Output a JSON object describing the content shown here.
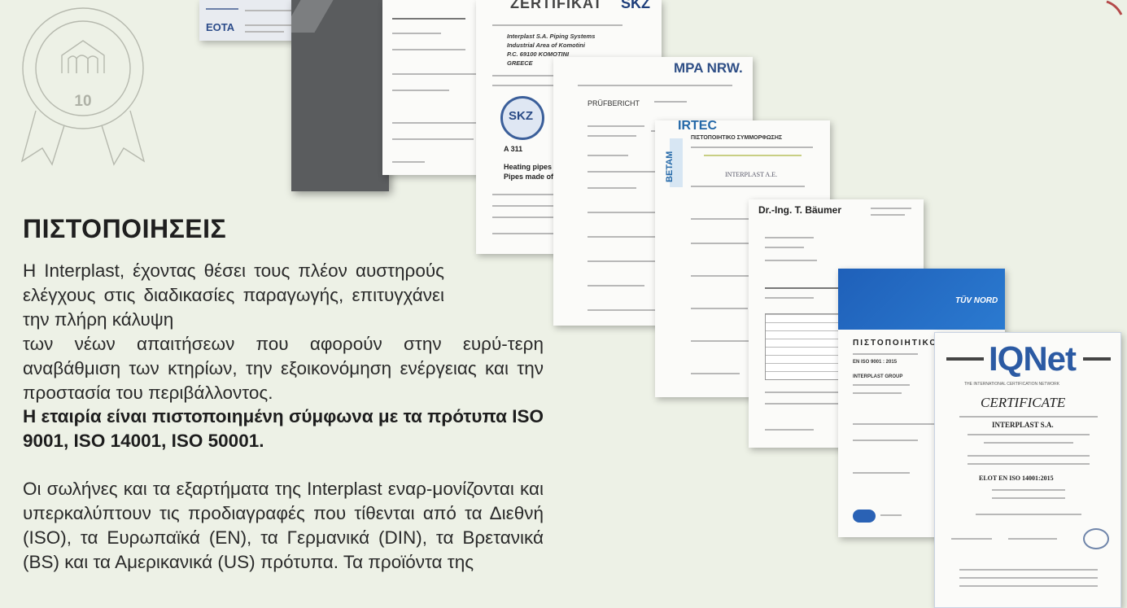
{
  "badge": {
    "number": "10"
  },
  "heading": "ΠΙΣΤΟΠΟΙΗΣΕΙΣ",
  "paragraphs": {
    "p1": "Η Interplast, έχοντας θέσει τους πλέον αυστηρούς ελέγχους στις διαδικασίες παραγωγής, επιτυγχάνει την πλήρη κάλυψη",
    "p2": "των νέων απαιτήσεων που αφορούν στην ευρύ-τερη αναβάθμιση των κτηρίων, την εξοικονόμηση ενέργειας και την προστασία του περιβάλλοντος.",
    "p3": "Η εταιρία είναι πιστοποιημένη σύμφωνα με τα πρότυπα ISO 9001, ISO 14001, ISO 50001.",
    "p4": "Οι σωλήνες και τα εξαρτήματα της Interplast εναρ-μονίζονται και υπερκαλύπτουν τις προδιαγραφές που τίθενται από τα Διεθνή (ISO), τα Ευρωπαϊκά (EN), τα Γερμανικά (DIN), τα Βρετανικά (BS) και τα Αμερικανικά (US) πρότυπα. Τα προϊόντα της"
  },
  "documents": {
    "eota": {
      "logo": "EOTA"
    },
    "skz": {
      "title": "ZERTIFIKAT",
      "logo": "SKZ",
      "company": "Interplast S.A. Piping Systems",
      "address1": "Industrial Area of Komotini",
      "address2": "P.C. 69100 KOMOTINI",
      "country": "GREECE",
      "seal": "SKZ",
      "number": "A 311",
      "product1": "Heating pipes",
      "product2": "Pipes made of cross"
    },
    "mpa": {
      "logo": "MPA NRW.",
      "title": "PRÜFBERICHT"
    },
    "irtec": {
      "logo": "IRTEC",
      "side": "BETAM",
      "title": "ΠΙΣΤΟΠΟΙΗΤΙΚΟ ΣΥΜΜΟΡΦΩΣΗΣ",
      "company": "INTERPLAST A.E."
    },
    "baumer": {
      "name": "Dr.-Ing. T. Bäumer"
    },
    "tuv": {
      "logo": "TÜV NORD",
      "title": "ΠΙΣΤΟΠΟΙΗΤΙΚΟ",
      "standard": "EN ISO 9001 : 2015",
      "company": "INTERPLAST GROUP"
    },
    "iqnet": {
      "logo": "IQNet",
      "tagline": "THE INTERNATIONAL CERTIFICATION NETWORK",
      "title": "CERTIFICATE",
      "company": "INTERPLAST S.A.",
      "standard": "ELOT EN ISO 14001:2015"
    }
  }
}
